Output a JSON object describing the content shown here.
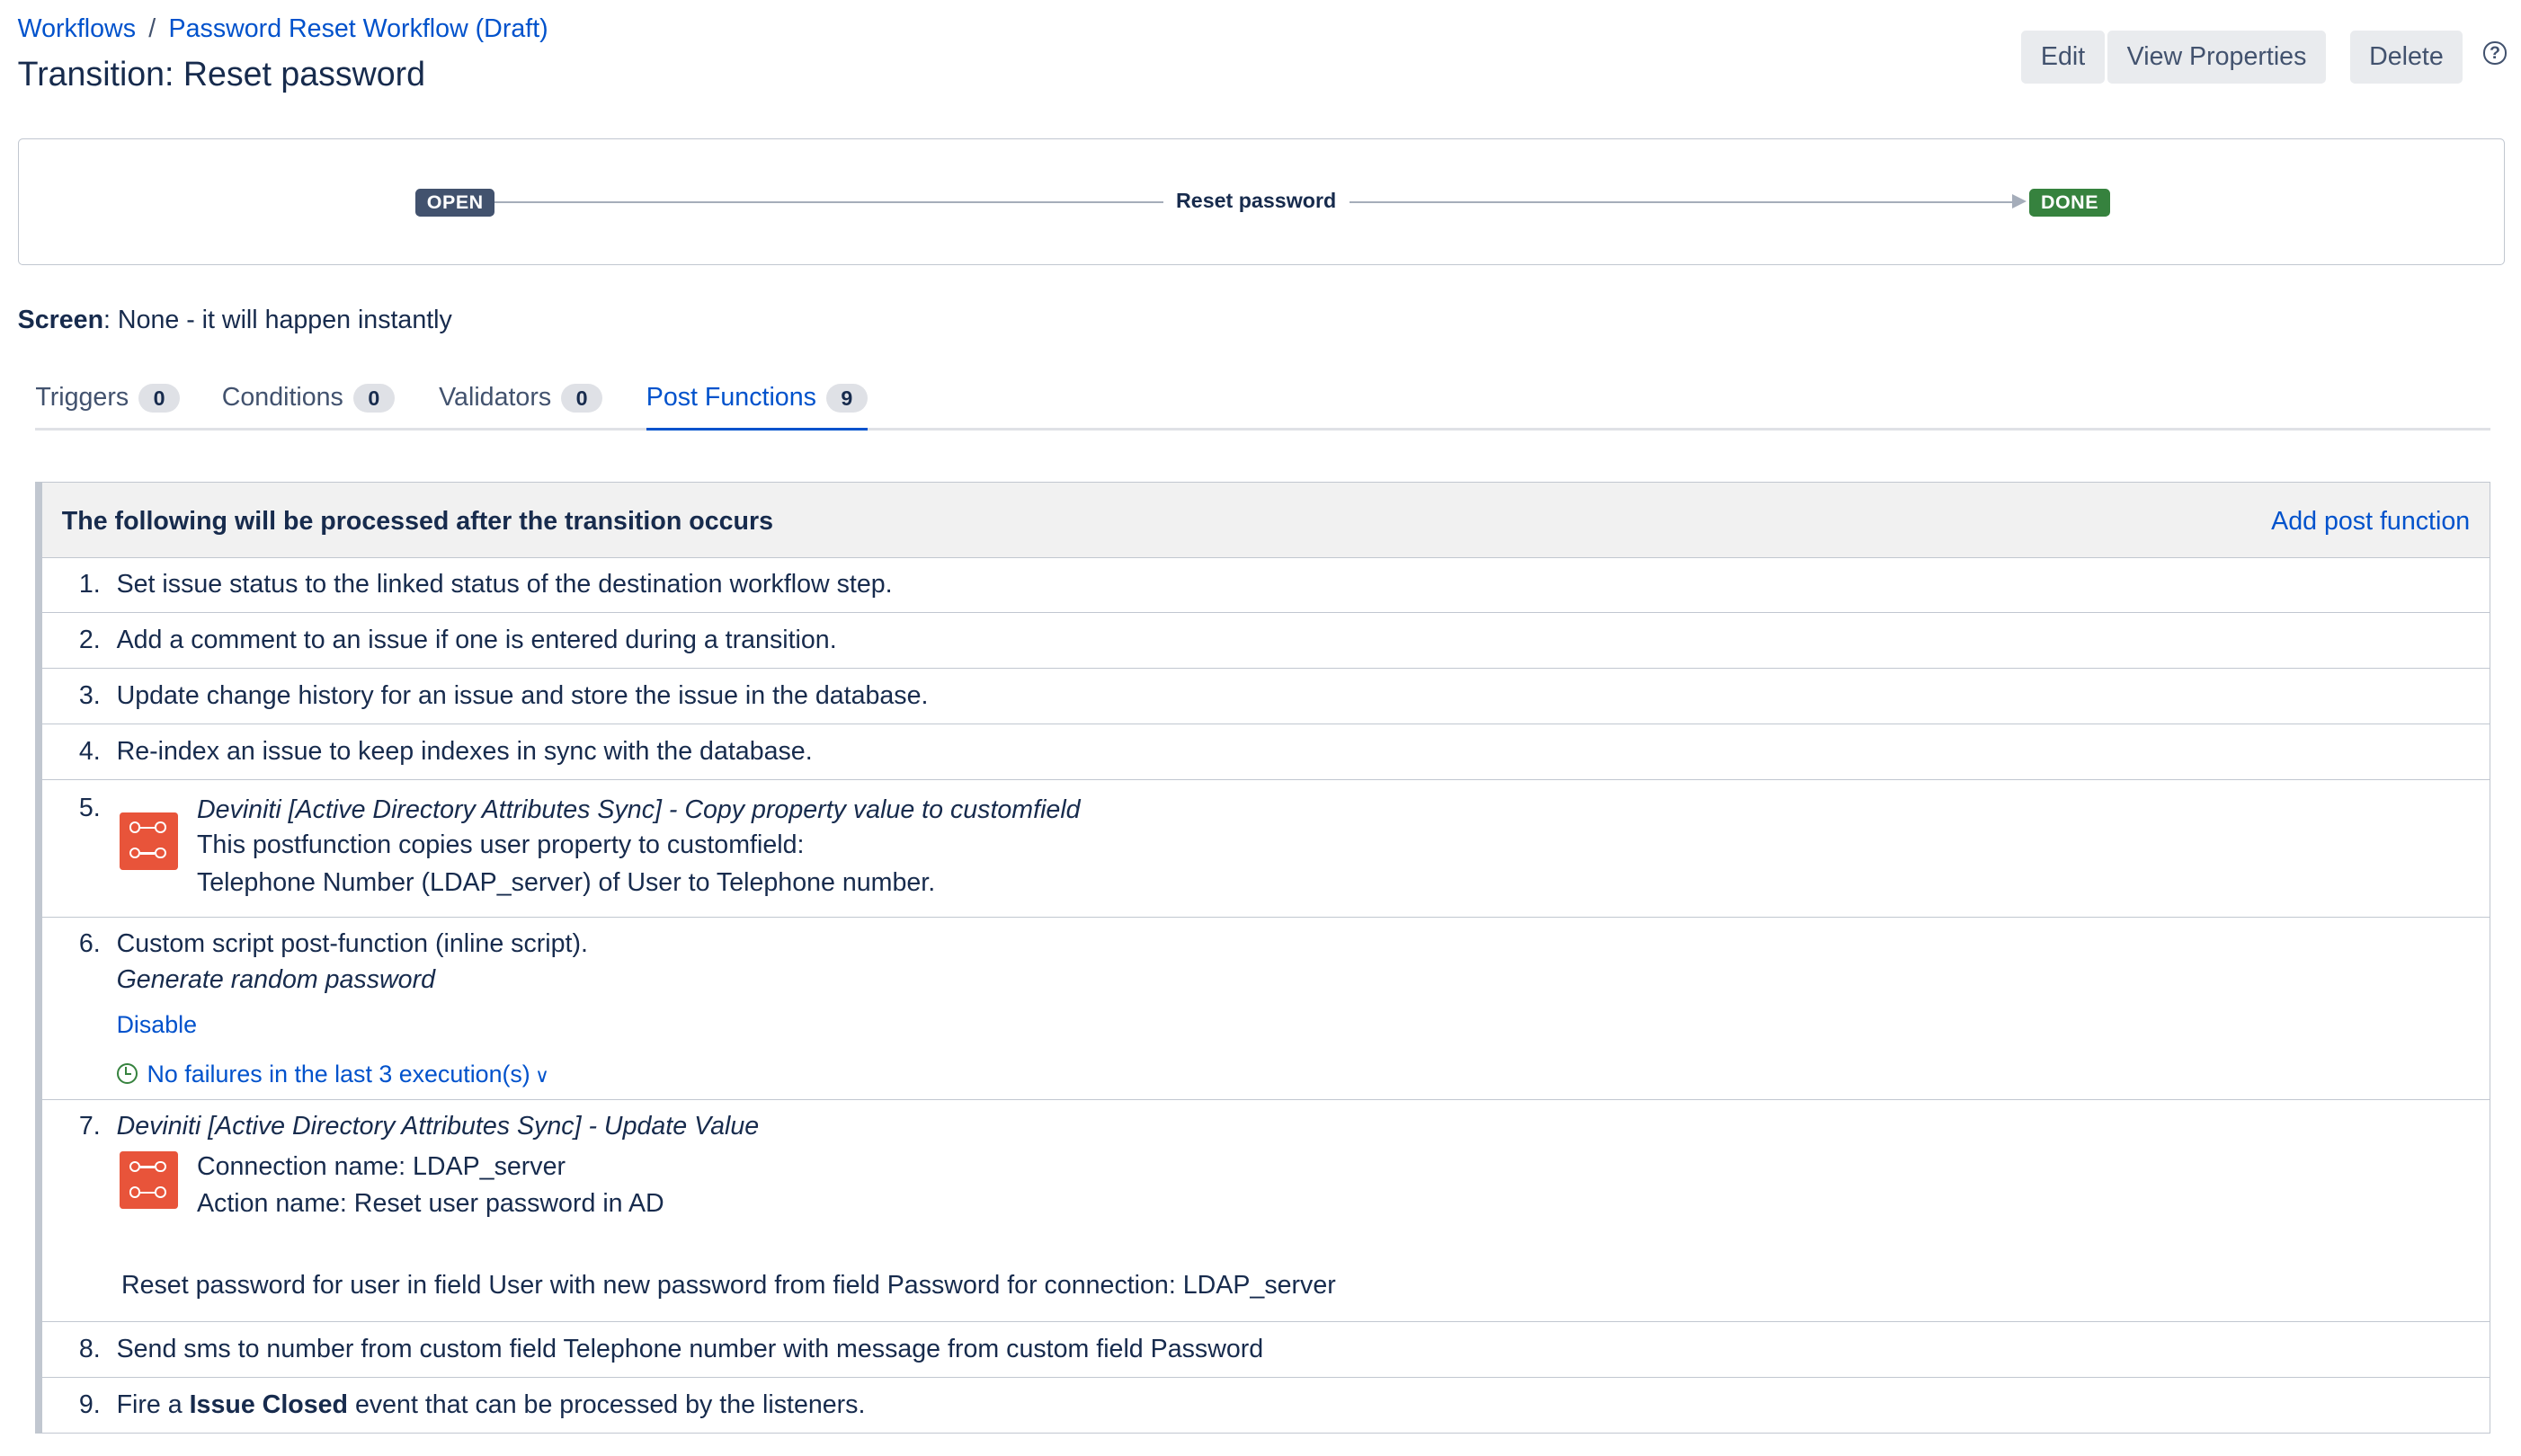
{
  "breadcrumb": {
    "root": "Workflows",
    "separator": "/",
    "workflow": "Password Reset Workflow (Draft)"
  },
  "page_title": "Transition: Reset password",
  "actions": {
    "edit": "Edit",
    "view_properties": "View Properties",
    "delete": "Delete",
    "help": "?"
  },
  "diagram": {
    "from_status": "OPEN",
    "transition": "Reset password",
    "to_status": "DONE",
    "colors": {
      "open": "#42526e",
      "done": "#36823e"
    }
  },
  "screen": {
    "label": "Screen",
    "value": ": None - it will happen instantly"
  },
  "tabs": [
    {
      "label": "Triggers",
      "count": "0"
    },
    {
      "label": "Conditions",
      "count": "0"
    },
    {
      "label": "Validators",
      "count": "0"
    },
    {
      "label": "Post Functions",
      "count": "9",
      "active": true
    }
  ],
  "post_functions": {
    "heading": "The following will be processed after the transition occurs",
    "add_label": "Add post function",
    "items": [
      {
        "num": "1.",
        "text": "Set issue status to the linked status of the destination workflow step."
      },
      {
        "num": "2.",
        "text": "Add a comment to an issue if one is entered during a transition."
      },
      {
        "num": "3.",
        "text": "Update change history for an issue and store the issue in the database."
      },
      {
        "num": "4.",
        "text": "Re-index an issue to keep indexes in sync with the database."
      },
      {
        "num": "5.",
        "title": "Deviniti [Active Directory Attributes Sync] - Copy property value to customfield",
        "line1": "This postfunction copies user property to customfield:",
        "line2": "Telephone Number (LDAP_server) of User to Telephone number.",
        "icon": "plugin-icon"
      },
      {
        "num": "6.",
        "text": "Custom script post-function (inline script).",
        "subtitle": "Generate random password",
        "disable": "Disable",
        "status": "No failures in the last 3 execution(s)"
      },
      {
        "num": "7.",
        "title": "Deviniti [Active Directory Attributes Sync] - Update Value",
        "line1": "Connection name: LDAP_server",
        "line2": "Action name: Reset user password in AD",
        "line3": "Reset password for user in field User with new password from field Password for connection: LDAP_server",
        "icon": "plugin-icon"
      },
      {
        "num": "8.",
        "text": "Send sms to number from custom field Telephone number with message from custom field Password"
      },
      {
        "num": "9.",
        "text_before": "Fire a ",
        "text_bold": "Issue Closed",
        "text_after": " event that can be processed by the listeners."
      }
    ]
  }
}
